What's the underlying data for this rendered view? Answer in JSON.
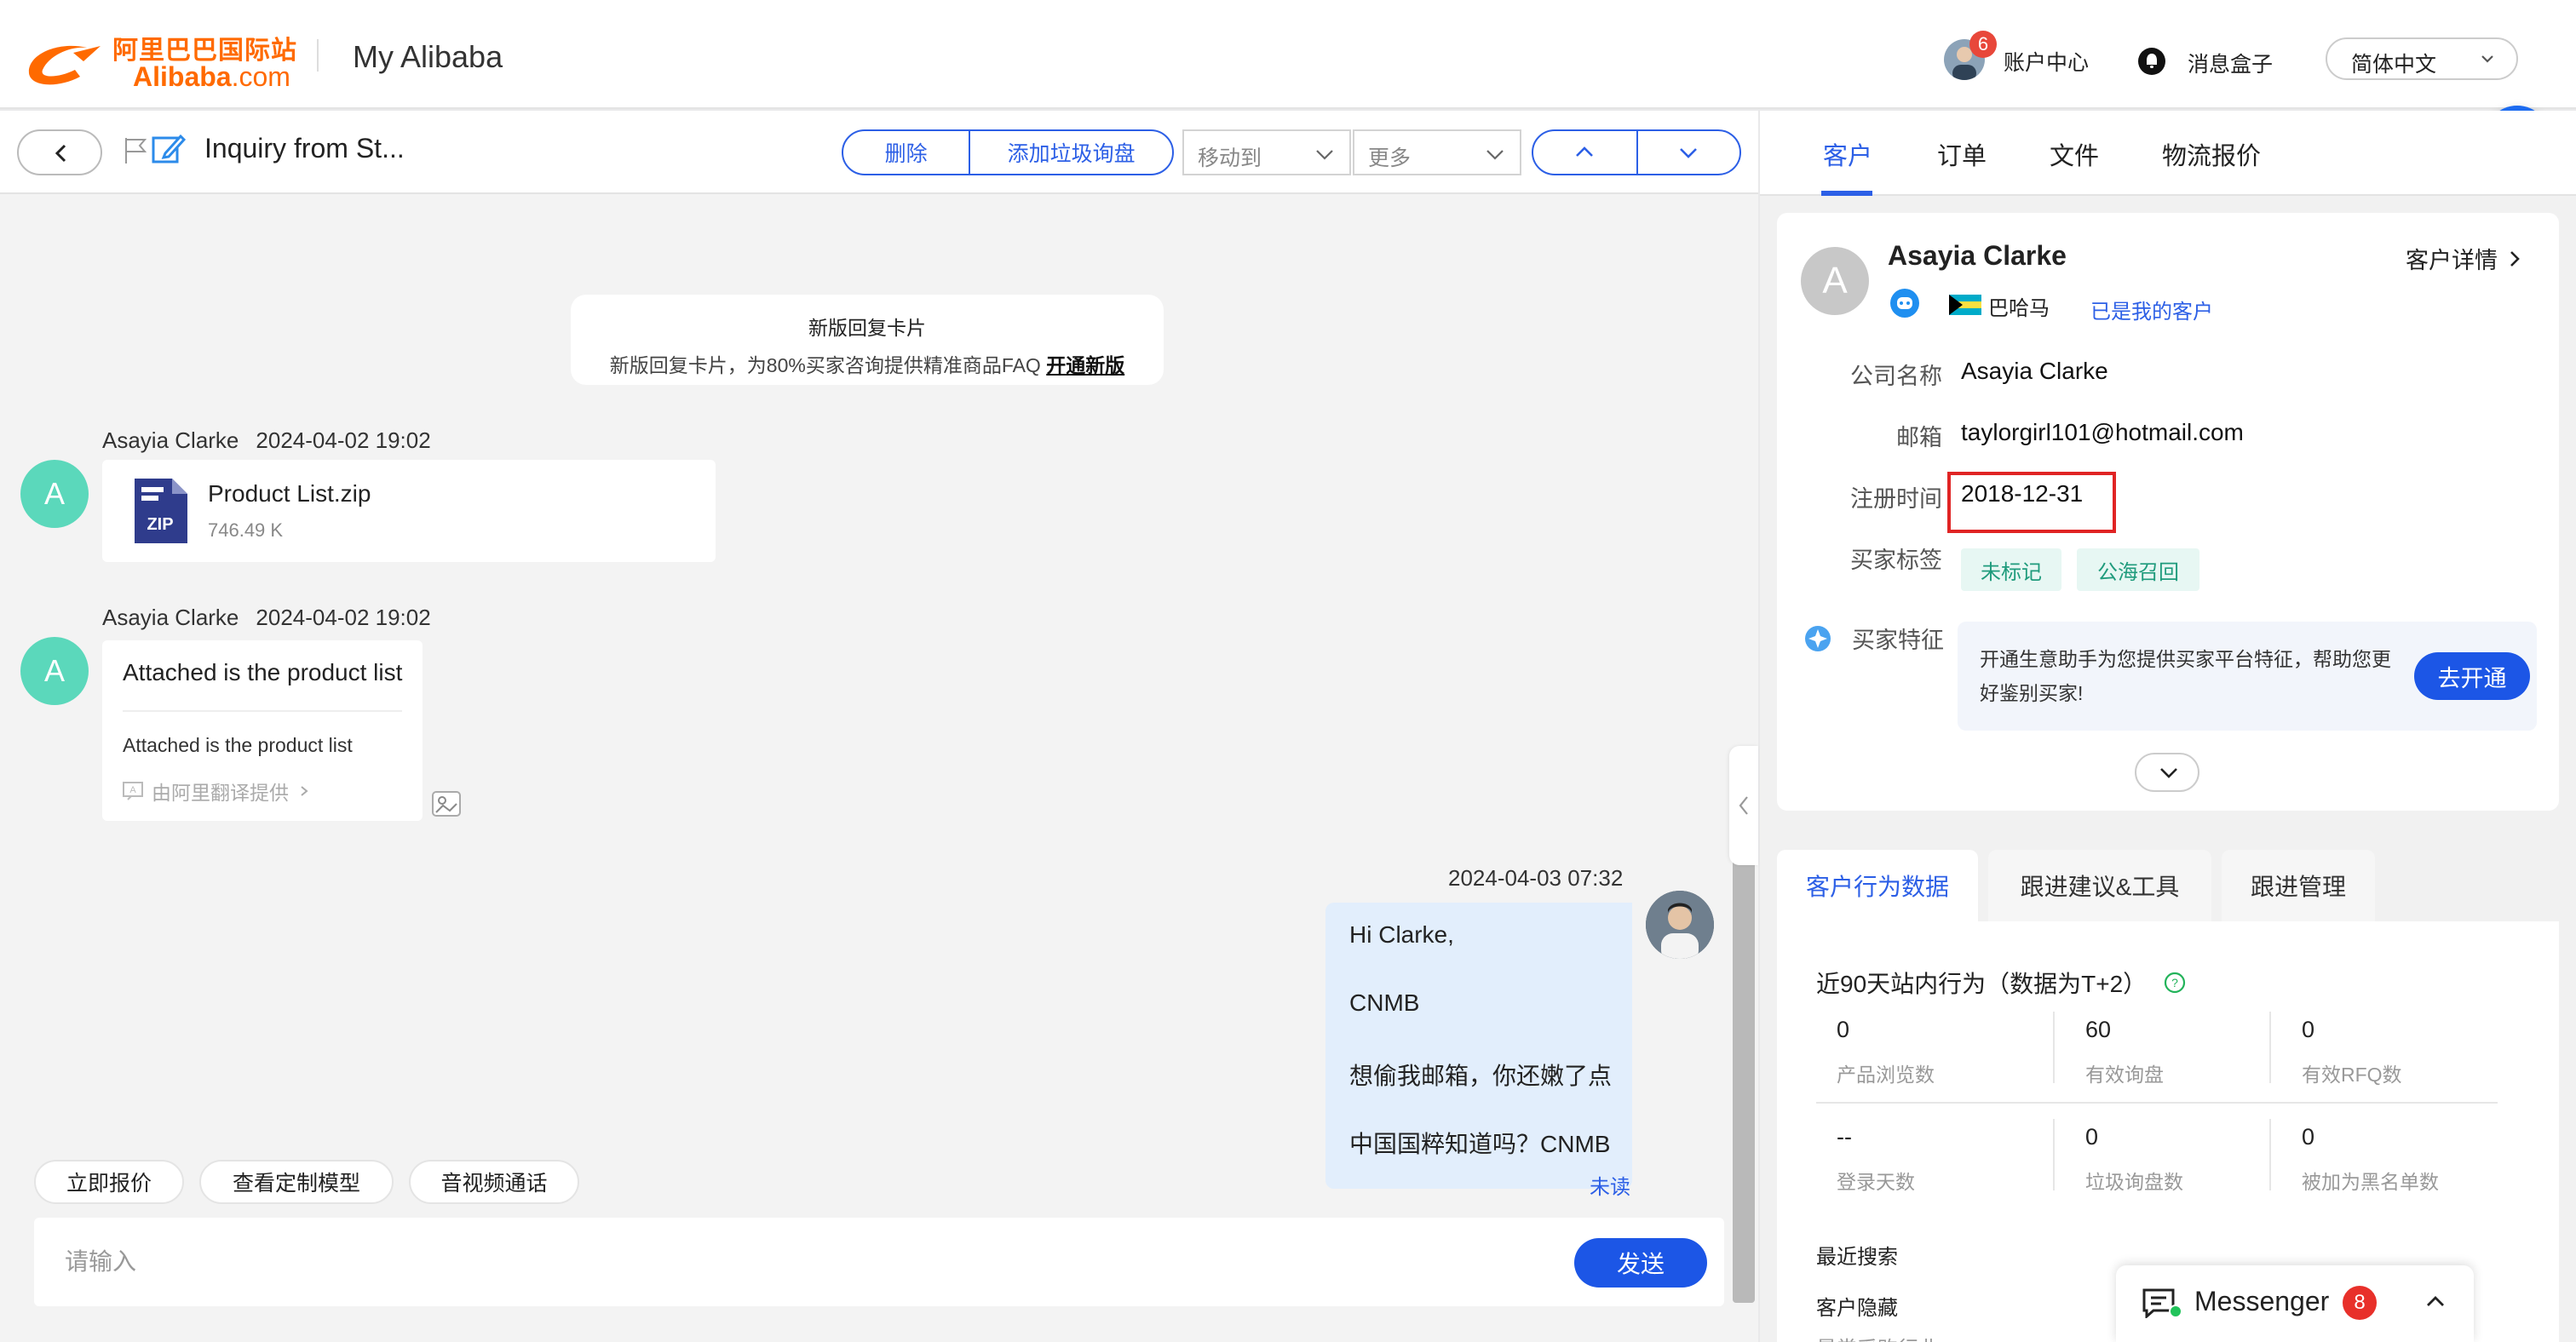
{
  "header": {
    "logo_cn": "阿里巴巴国际站",
    "logo_en_brand": "Alibaba",
    "logo_en_tld": ".com",
    "app_title": "My Alibaba",
    "account_label": "账户中心",
    "account_badge": "6",
    "message_box_label": "消息盒子",
    "language": "简体中文"
  },
  "toolbar": {
    "inquiry_title": "Inquiry from St...",
    "delete_label": "删除",
    "add_spam_label": "添加垃圾询盘",
    "move_to_label": "移动到",
    "more_label": "更多"
  },
  "notice": {
    "title": "新版回复卡片",
    "desc": "新版回复卡片，为80%买家咨询提供精准商品FAQ",
    "link": "开通新版"
  },
  "messages": [
    {
      "sender": "Asayia Clarke",
      "time": "2024-04-02 19:02",
      "avatar_letter": "A",
      "file_name": "Product List.zip",
      "file_size": "746.49 K",
      "file_icon_label": "ZIP"
    },
    {
      "sender": "Asayia Clarke",
      "time": "2024-04-02 19:02",
      "avatar_letter": "A",
      "text": "Attached is the product list",
      "translation": "Attached is the product list",
      "provider": "由阿里翻译提供"
    }
  ],
  "outgoing": {
    "time": "2024-04-03 07:32",
    "lines": [
      "Hi Clarke,",
      "CNMB",
      "想偷我邮箱，你还嫩了点",
      "中国国粹知道吗？CNMB"
    ],
    "status": "未读"
  },
  "quick_actions": [
    "立即报价",
    "查看定制模型",
    "音视频通话"
  ],
  "composer": {
    "placeholder": "请输入",
    "send_label": "发送"
  },
  "right_tabs": [
    "客户",
    "订单",
    "文件",
    "物流报价"
  ],
  "customer": {
    "avatar_letter": "A",
    "name": "Asayia Clarke",
    "detail_link": "客户详情",
    "country": "巴哈马",
    "status_link": "已是我的客户",
    "fields": [
      {
        "label": "公司名称",
        "value": "Asayia Clarke"
      },
      {
        "label": "邮箱",
        "value": "taylorgirl101@hotmail.com"
      },
      {
        "label": "注册时间",
        "value": "2018-12-31"
      }
    ],
    "tags_label": "买家标签",
    "tags": [
      "未标记",
      "公海召回"
    ],
    "feature_label": "买家特征",
    "feature_text": "开通生意助手为您提供买家平台特征，帮助您更好鉴别买家!",
    "feature_button": "去开通"
  },
  "behavior_tabs": [
    "客户行为数据",
    "跟进建议&工具",
    "跟进管理"
  ],
  "behavior": {
    "title": "近90天站内行为（数据为T+2）",
    "stats": [
      {
        "value": "0",
        "label": "产品浏览数"
      },
      {
        "value": "60",
        "label": "有效询盘"
      },
      {
        "value": "0",
        "label": "有效RFQ数"
      },
      {
        "value": "--",
        "label": "登录天数"
      },
      {
        "value": "0",
        "label": "垃圾询盘数"
      },
      {
        "value": "0",
        "label": "被加为黑名单数"
      }
    ],
    "recent_search_label": "最近搜索",
    "hidden_label": "客户隐藏",
    "cut_label": "最常采购行业"
  },
  "messenger": {
    "label": "Messenger",
    "badge": "8"
  },
  "colors": {
    "brand_orange": "#ff6a00",
    "primary_blue": "#1c56e6",
    "avatar_green": "#5bd8bb",
    "highlight_red": "#e02424"
  }
}
